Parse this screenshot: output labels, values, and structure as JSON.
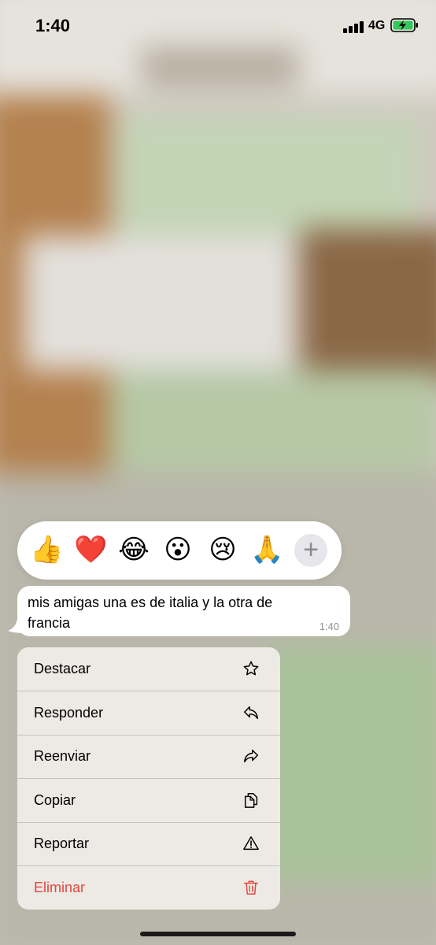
{
  "status_bar": {
    "time": "1:40",
    "network": "4G",
    "battery_icon": "battery-charging-icon",
    "signal_icon": "signal-bars-icon"
  },
  "reactions": {
    "items": [
      "👍",
      "❤️",
      "😂",
      "😮",
      "😢",
      "🙏"
    ],
    "more_label": "+"
  },
  "message": {
    "text": "mis amigas una es de italia y la otra de francia",
    "time": "1:40"
  },
  "menu": {
    "items": [
      {
        "label": "Destacar",
        "icon": "star-icon"
      },
      {
        "label": "Responder",
        "icon": "reply-icon"
      },
      {
        "label": "Reenviar",
        "icon": "forward-icon"
      },
      {
        "label": "Copiar",
        "icon": "copy-icon"
      },
      {
        "label": "Reportar",
        "icon": "warning-icon"
      },
      {
        "label": "Eliminar",
        "icon": "trash-icon"
      }
    ],
    "danger_color": "#e5453b"
  }
}
